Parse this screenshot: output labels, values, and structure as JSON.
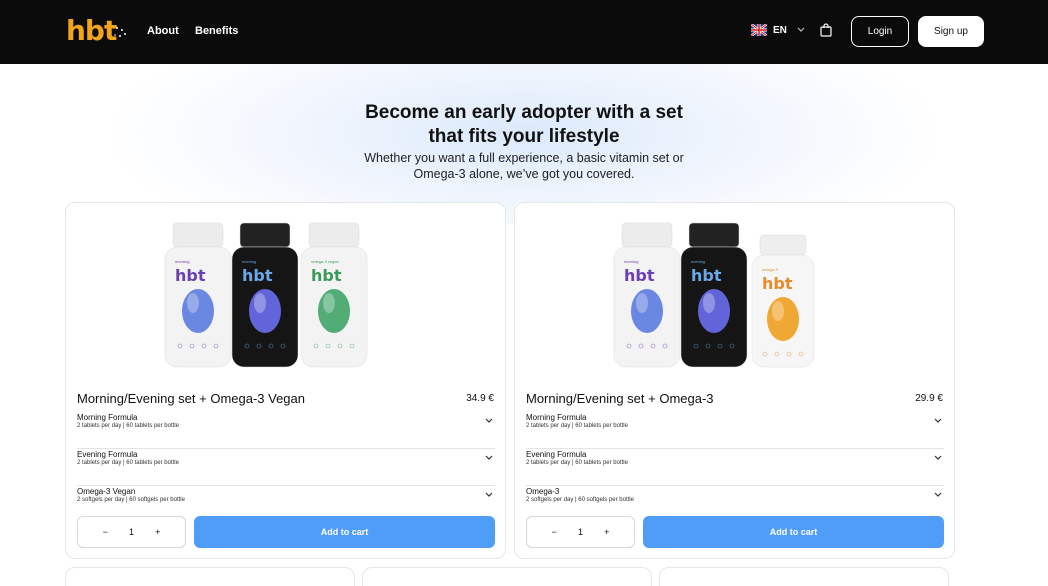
{
  "header": {
    "logo": "hbt",
    "nav": [
      {
        "label": "About"
      },
      {
        "label": "Benefits"
      }
    ],
    "language": "EN",
    "login_label": "Login",
    "signup_label": "Sign up"
  },
  "hero": {
    "title_line1": "Become an early adopter with a set",
    "title_line2": "that fits your lifestyle",
    "subtitle_line1": "Whether you want a full experience, a basic vitamin set or",
    "subtitle_line2": "Omega-3 alone, we’ve got you covered."
  },
  "products": [
    {
      "name": "Morning/Evening set + Omega-3 Vegan",
      "price": "34.9 €",
      "bottles": [
        {
          "label": "morning",
          "brand": "hbt",
          "body": "#f3f3f3",
          "cap": "#ececec",
          "text": "#6a3fb4",
          "gem": "#5b7be0"
        },
        {
          "label": "evening",
          "brand": "hbt",
          "body": "#151515",
          "cap": "#222222",
          "text": "#6aa8e8",
          "gem": "#6a6ef0"
        },
        {
          "label": "omega-3 vegan",
          "brand": "hbt",
          "body": "#f3f3f3",
          "cap": "#ececec",
          "text": "#3a9a5a",
          "gem": "#3fa468"
        }
      ],
      "formulas": [
        {
          "title": "Morning Formula",
          "desc": "2 tablets per day | 60 tablets per bottle"
        },
        {
          "title": "Evening Formula",
          "desc": "2 tablets per day | 60 tablets per bottle"
        },
        {
          "title": "Omega-3 Vegan",
          "desc": "2 softgels per day | 60 softgels per bottle"
        }
      ],
      "qty_minus": "−",
      "qty": "1",
      "qty_plus": "+",
      "add_to_cart": "Add to cart"
    },
    {
      "name": "Morning/Evening set + Omega-3",
      "price": "29.9 €",
      "bottles": [
        {
          "label": "morning",
          "brand": "hbt",
          "body": "#f3f3f3",
          "cap": "#ececec",
          "text": "#6a3fb4",
          "gem": "#5b7be0"
        },
        {
          "label": "evening",
          "brand": "hbt",
          "body": "#151515",
          "cap": "#222222",
          "text": "#6aa8e8",
          "gem": "#6a6ef0"
        },
        {
          "label": "omega-3",
          "brand": "hbt",
          "body": "#f6f6f6",
          "cap": "#eeeeee",
          "text": "#e88a2a",
          "gem": "#f0a020"
        }
      ],
      "formulas": [
        {
          "title": "Morning Formula",
          "desc": "2 tablets per day | 60 tablets per bottle"
        },
        {
          "title": "Evening Formula",
          "desc": "2 tablets per day | 60 tablets per bottle"
        },
        {
          "title": "Omega-3",
          "desc": "2 softgels per day | 60 softgels per bottle"
        }
      ],
      "qty_minus": "−",
      "qty": "1",
      "qty_plus": "+",
      "add_to_cart": "Add to cart"
    }
  ],
  "colors": {
    "header_bg": "#0b0b0b",
    "logo": "#f2a51a",
    "accent": "#4f9df7"
  }
}
